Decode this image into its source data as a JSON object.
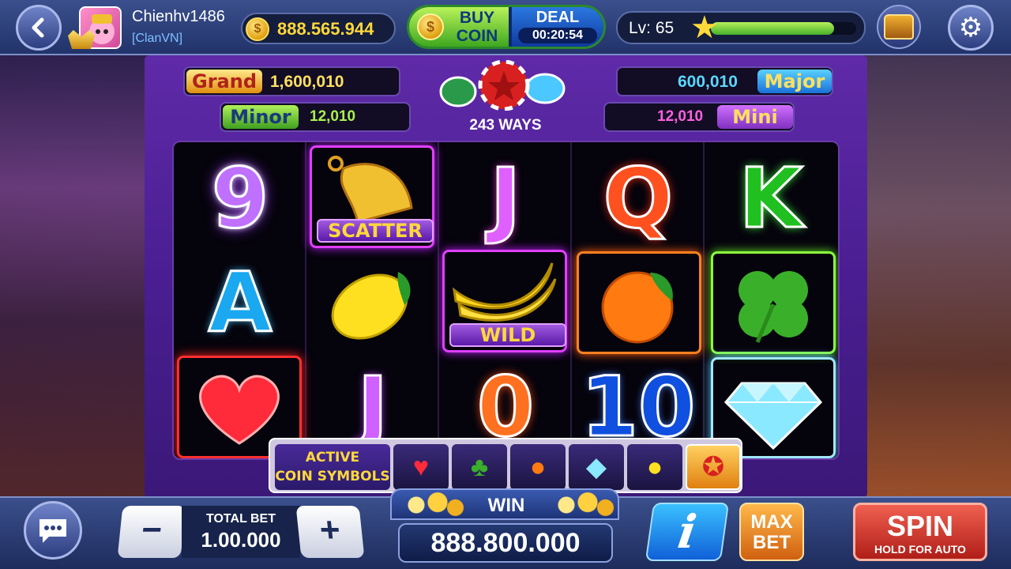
{
  "header": {
    "username": "Chienhv1486",
    "clan": "[ClanVN]",
    "coins": "888.565.944",
    "buy_coin_label": "BUY COIN",
    "deal_label": "DEAL",
    "deal_timer": "00:20:54",
    "level": "Lv: 65",
    "xp_progress": 0.85
  },
  "jackpots": {
    "grand": {
      "label": "Grand",
      "value": "1,600,010"
    },
    "major": {
      "label": "Major",
      "value": "600,010"
    },
    "minor": {
      "label": "Minor",
      "value": "12,010"
    },
    "mini": {
      "label": "Mini",
      "value": "12,010"
    }
  },
  "ways": "243 WAYS",
  "reels": [
    [
      "9",
      "A",
      "heart"
    ],
    [
      "scatter",
      "lemon",
      "J"
    ],
    [
      "J",
      "wild",
      "0"
    ],
    [
      "Q",
      "orange",
      "10"
    ],
    [
      "K",
      "clover",
      "diamond"
    ]
  ],
  "labels": {
    "scatter": "SCATTER",
    "wild": "WILD"
  },
  "active_symbols": {
    "title_line1": "ACTIVE",
    "title_line2": "COIN SYMBOLS",
    "icons": [
      "heart-icon",
      "clover-icon",
      "orange-icon",
      "diamond-icon",
      "lemon-icon",
      "chip-icon"
    ]
  },
  "footer": {
    "total_bet_label": "TOTAL BET",
    "total_bet": "1.00.000",
    "minus": "−",
    "plus": "+",
    "win_label": "WIN",
    "win_value": "888.800.000",
    "info": "i",
    "max_bet": "MAX BET",
    "spin": "SPIN",
    "spin_sub": "HOLD FOR AUTO"
  },
  "colors": {
    "gold": "#ffd83a",
    "machine_purple": "#5f2aa8",
    "spin_red": "#d0362a",
    "buy_green": "#3fa81f"
  }
}
